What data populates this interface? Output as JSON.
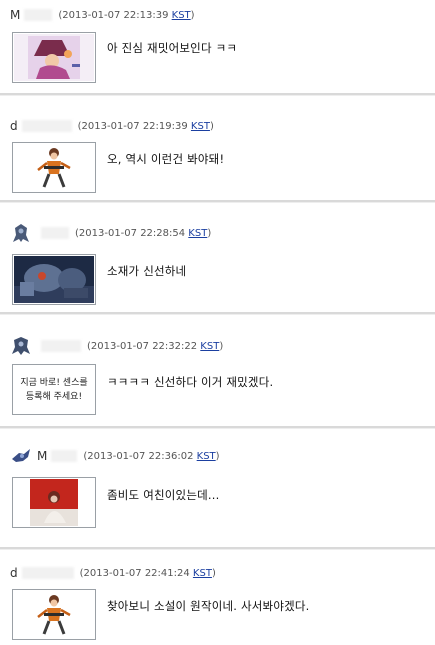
{
  "comments": [
    {
      "nick": "M",
      "timestamp": "(2013-01-07 22:13:39",
      "tz": "KST",
      "close": ")",
      "text": "아 진심 재밋어보인다 ㅋㅋ",
      "thumb_icon": "anime-witch-image",
      "avatar_icon": ""
    },
    {
      "nick": "d",
      "timestamp": "(2013-01-07 22:19:39",
      "tz": "KST",
      "close": ")",
      "text": "오, 역시 이런건 봐야돼!",
      "thumb_icon": "anime-girl-image",
      "avatar_icon": ""
    },
    {
      "nick": "",
      "timestamp": "(2013-01-07 22:28:54",
      "tz": "KST",
      "close": ")",
      "text": "소재가 신선하네",
      "thumb_icon": "robot-mech-image",
      "avatar_icon": "mech-avatar-icon"
    },
    {
      "nick": "",
      "timestamp": "(2013-01-07 22:32:22",
      "tz": "KST",
      "close": ")",
      "text": "ㅋㅋㅋㅋ 신선하다 이거 재밌겠다.",
      "thumb_icon": "handwritten-text-image",
      "thumb_text_line1": "지금 바로! 센스를",
      "thumb_text_line2": "등록해 주세요!",
      "avatar_icon": "mech-avatar-icon"
    },
    {
      "nick": "M",
      "timestamp": "(2013-01-07 22:36:02",
      "tz": "KST",
      "close": ")",
      "text": "좀비도 여친이있는데...",
      "thumb_icon": "zombie-girl-image",
      "avatar_icon": "ship-avatar-icon"
    },
    {
      "nick": "d",
      "timestamp": "(2013-01-07 22:41:24",
      "tz": "KST",
      "close": ")",
      "text": "찾아보니 소설이 원작이네. 사서봐야겠다.",
      "thumb_icon": "anime-girl-image",
      "avatar_icon": ""
    }
  ],
  "colors": {
    "link": "#1b3fa0",
    "separator": "#d9d9d9"
  }
}
